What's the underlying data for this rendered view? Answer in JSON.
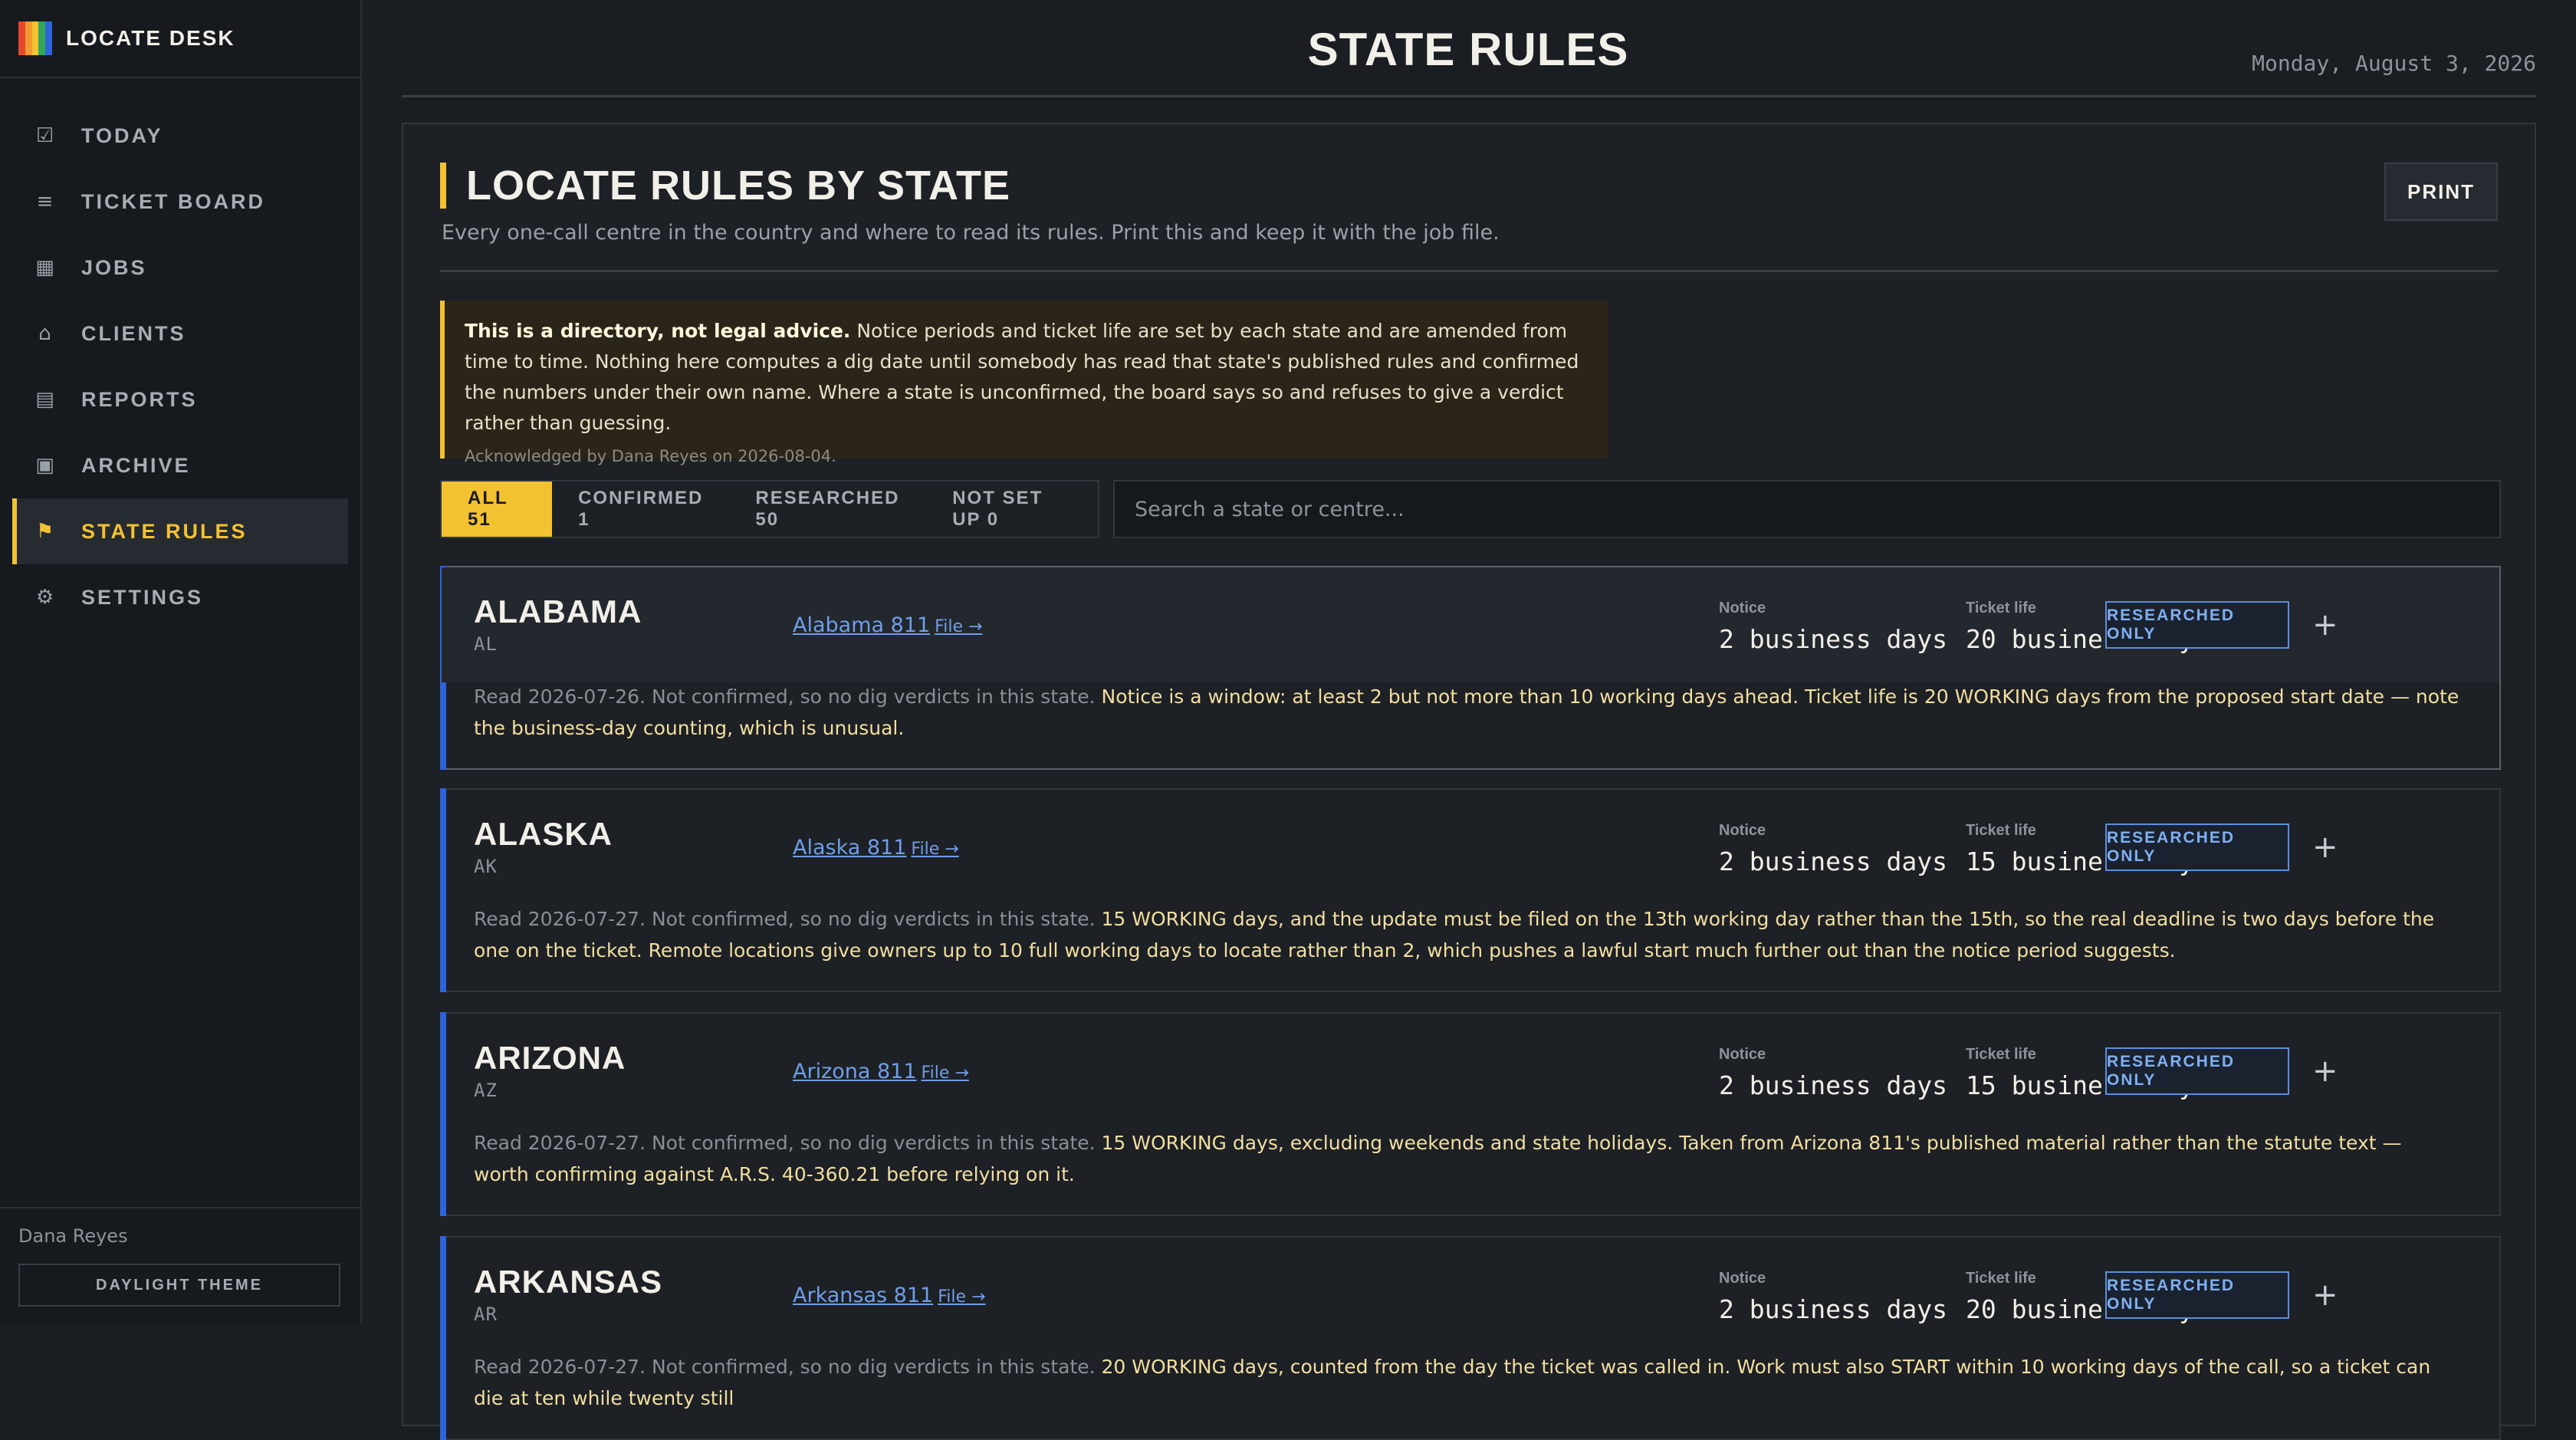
{
  "app": {
    "name": "LOCATE DESK",
    "logo_colors": [
      "#e6482c",
      "#f2c230",
      "#2fa85b",
      "#2f63d9",
      "#f2c230",
      "#e6482c"
    ]
  },
  "sidebar": {
    "items": [
      {
        "label": "TODAY",
        "icon": "checkbox-icon",
        "glyph": "☑"
      },
      {
        "label": "TICKET BOARD",
        "icon": "list-icon",
        "glyph": "≡"
      },
      {
        "label": "JOBS",
        "icon": "grid-icon",
        "glyph": "▦"
      },
      {
        "label": "CLIENTS",
        "icon": "home-icon",
        "glyph": "⌂"
      },
      {
        "label": "REPORTS",
        "icon": "report-icon",
        "glyph": "▤"
      },
      {
        "label": "ARCHIVE",
        "icon": "archive-icon",
        "glyph": "▣"
      },
      {
        "label": "STATE RULES",
        "icon": "flag-icon",
        "glyph": "⚑",
        "active": true
      },
      {
        "label": "SETTINGS",
        "icon": "gear-icon",
        "glyph": "⚙"
      }
    ],
    "user": "Dana Reyes",
    "theme_button": "DAYLIGHT THEME"
  },
  "header": {
    "title": "STATE RULES",
    "date": "Monday, August 3, 2026"
  },
  "panel": {
    "title": "LOCATE RULES BY STATE",
    "print_label": "PRINT",
    "subtitle": "Every one-call centre in the country and where to read its rules. Print this and keep it with the job file."
  },
  "disclaimer": {
    "bold": "This is a directory, not legal advice.",
    "text": " Notice periods and ticket life are set by each state and are amended from time to time. Nothing here computes a dig date until somebody has read that state's published rules and confirmed the numbers under their own name. Where a state is unconfirmed, the board says so and refuses to give a verdict rather than guessing.",
    "ack": "Acknowledged by Dana Reyes on 2026-08-04."
  },
  "filters": [
    {
      "label": "ALL 51",
      "active": true
    },
    {
      "label": "CONFIRMED 1"
    },
    {
      "label": "RESEARCHED 50"
    },
    {
      "label": "NOT SET UP 0"
    }
  ],
  "search": {
    "placeholder": "Search a state or centre..."
  },
  "labels": {
    "notice": "Notice",
    "ticket_life": "Ticket life",
    "file": "File →",
    "plus": "+"
  },
  "states": [
    {
      "name": "ALABAMA",
      "abbr": "AL",
      "centre": "Alabama 811",
      "notice": "2 business days",
      "ticket_life": "20 business days",
      "status": "RESEARCHED ONLY",
      "read_note": "Read 2026-07-26. Not confirmed, so no dig verdicts in this state.",
      "note": "Notice is a window: at least 2 but not more than 10 working days ahead. Ticket life is 20 WORKING days from the proposed start date — note the business-day counting, which is unusual."
    },
    {
      "name": "ALASKA",
      "abbr": "AK",
      "centre": "Alaska 811",
      "notice": "2 business days",
      "ticket_life": "15 business days",
      "status": "RESEARCHED ONLY",
      "read_note": "Read 2026-07-27. Not confirmed, so no dig verdicts in this state.",
      "note": "15 WORKING days, and the update must be filed on the 13th working day rather than the 15th, so the real deadline is two days before the one on the ticket. Remote locations give owners up to 10 full working days to locate rather than 2, which pushes a lawful start much further out than the notice period suggests."
    },
    {
      "name": "ARIZONA",
      "abbr": "AZ",
      "centre": "Arizona 811",
      "notice": "2 business days",
      "ticket_life": "15 business days",
      "status": "RESEARCHED ONLY",
      "read_note": "Read 2026-07-27. Not confirmed, so no dig verdicts in this state.",
      "note": "15 WORKING days, excluding weekends and state holidays. Taken from Arizona 811's published material rather than the statute text — worth confirming against A.R.S. 40-360.21 before relying on it."
    },
    {
      "name": "ARKANSAS",
      "abbr": "AR",
      "centre": "Arkansas 811",
      "notice": "2 business days",
      "ticket_life": "20 business days",
      "status": "RESEARCHED ONLY",
      "read_note": "Read 2026-07-27. Not confirmed, so no dig verdicts in this state.",
      "note": "20 WORKING days, counted from the day the ticket was called in. Work must also START within 10 working days of the call, so a ticket can die at ten while twenty still"
    }
  ]
}
